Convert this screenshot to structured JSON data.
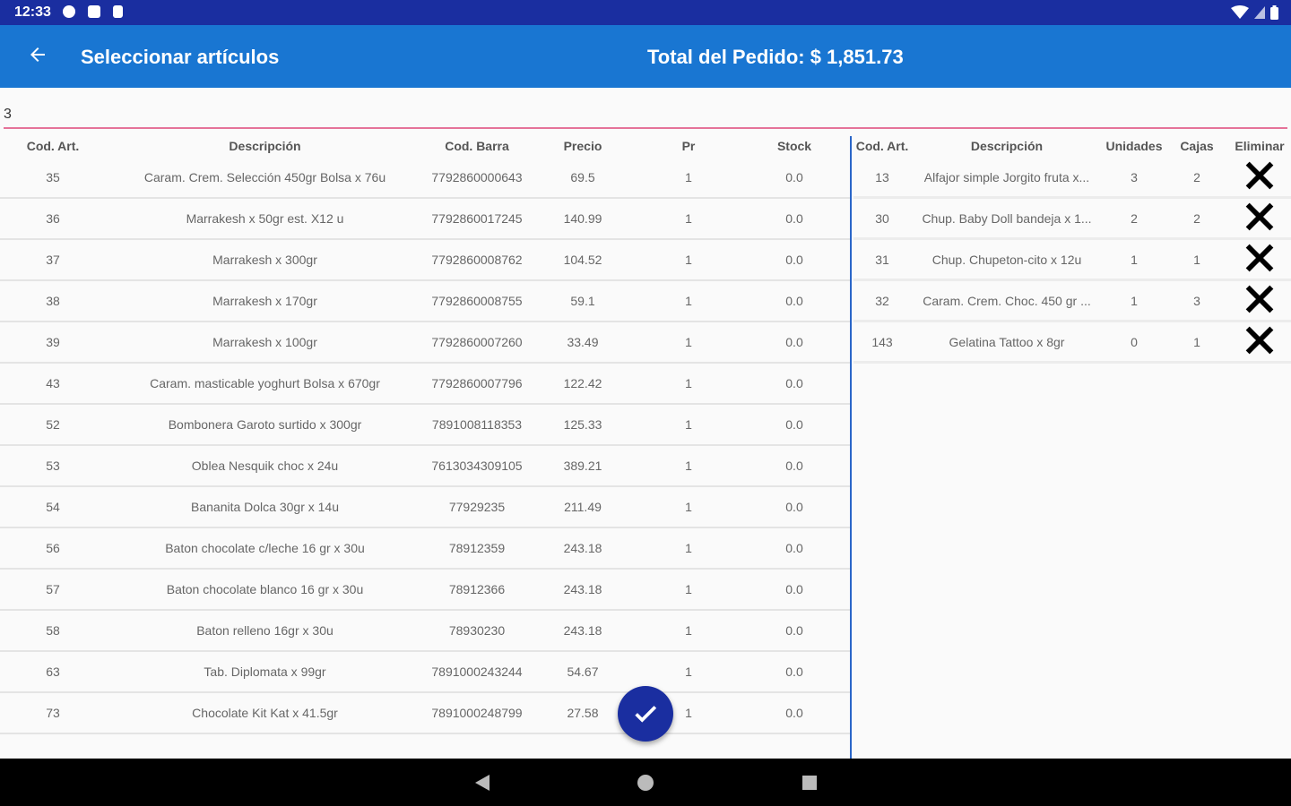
{
  "status_bar": {
    "time": "12:33"
  },
  "app_bar": {
    "title": "Seleccionar artículos",
    "total": "Total del Pedido: $ 1,851.73"
  },
  "search": {
    "value": "3"
  },
  "left_table": {
    "headers": [
      "Cod. Art.",
      "Descripción",
      "Cod. Barra",
      "Precio",
      "Pr",
      "Stock"
    ],
    "rows": [
      [
        "35",
        "Caram. Crem. Selección 450gr Bolsa x 76u",
        "7792860000643",
        "69.5",
        "1",
        "0.0"
      ],
      [
        "36",
        "Marrakesh x 50gr est. X12 u",
        "7792860017245",
        "140.99",
        "1",
        "0.0"
      ],
      [
        "37",
        "Marrakesh x 300gr",
        "7792860008762",
        "104.52",
        "1",
        "0.0"
      ],
      [
        "38",
        "Marrakesh x 170gr",
        "7792860008755",
        "59.1",
        "1",
        "0.0"
      ],
      [
        "39",
        "Marrakesh x 100gr",
        "7792860007260",
        "33.49",
        "1",
        "0.0"
      ],
      [
        "43",
        "Caram. masticable yoghurt Bolsa x 670gr",
        "7792860007796",
        "122.42",
        "1",
        "0.0"
      ],
      [
        "52",
        "Bombonera Garoto surtido x 300gr",
        "7891008118353",
        "125.33",
        "1",
        "0.0"
      ],
      [
        "53",
        "Oblea Nesquik choc x 24u",
        "7613034309105",
        "389.21",
        "1",
        "0.0"
      ],
      [
        "54",
        "Bananita Dolca 30gr x 14u",
        "77929235",
        "211.49",
        "1",
        "0.0"
      ],
      [
        "56",
        "Baton chocolate c/leche 16 gr x 30u",
        "78912359",
        "243.18",
        "1",
        "0.0"
      ],
      [
        "57",
        "Baton chocolate blanco 16 gr x 30u",
        "78912366",
        "243.18",
        "1",
        "0.0"
      ],
      [
        "58",
        "Baton relleno 16gr x 30u",
        "78930230",
        "243.18",
        "1",
        "0.0"
      ],
      [
        "63",
        "Tab. Diplomata x 99gr",
        "7891000243244",
        "54.67",
        "1",
        "0.0"
      ],
      [
        "73",
        "Chocolate Kit Kat x 41.5gr",
        "7891000248799",
        "27.58",
        "1",
        "0.0"
      ],
      [
        "",
        "",
        "",
        "",
        "",
        ""
      ]
    ]
  },
  "right_table": {
    "headers": [
      "Cod. Art.",
      "Descripción",
      "Unidades",
      "Cajas",
      "Eliminar"
    ],
    "rows": [
      [
        "13",
        "Alfajor simple Jorgito fruta x...",
        "3",
        "2"
      ],
      [
        "30",
        "Chup. Baby Doll bandeja x 1...",
        "2",
        "2"
      ],
      [
        "31",
        "Chup. Chupeton-cito x 12u",
        "1",
        "1"
      ],
      [
        "32",
        "Caram. Crem. Choc. 450 gr ...",
        "1",
        "3"
      ],
      [
        "143",
        "Gelatina Tattoo x 8gr",
        "0",
        "1"
      ]
    ]
  },
  "colors": {
    "status_bar": "#1a2ea0",
    "app_bar": "#1976d2",
    "fab": "#1a2ea0",
    "search_underline": "#e57399",
    "divider": "#2a66c8"
  },
  "icons": {
    "back": "arrow-left-icon",
    "fab": "check-icon",
    "delete": "close-icon"
  }
}
